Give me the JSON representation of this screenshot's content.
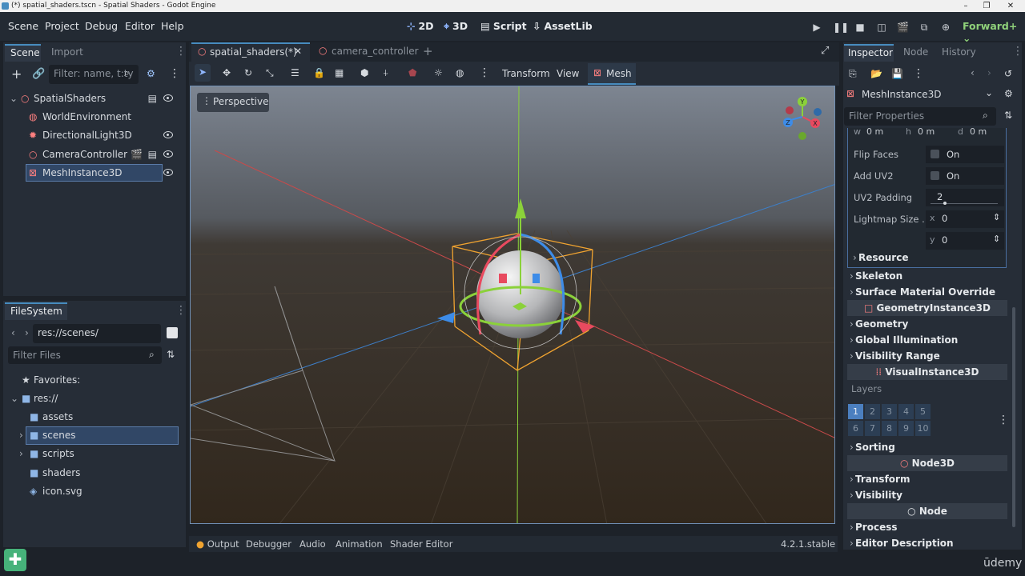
{
  "window": {
    "title": "(*) spatial_shaders.tscn - Spatial Shaders - Godot Engine"
  },
  "menu": [
    "Scene",
    "Project",
    "Debug",
    "Editor",
    "Help"
  ],
  "workspaces": [
    {
      "label": "2D",
      "icon": "2d-icon"
    },
    {
      "label": "3D",
      "icon": "3d-icon"
    },
    {
      "label": "Script",
      "icon": "script-icon"
    },
    {
      "label": "AssetLib",
      "icon": "assetlib-icon"
    }
  ],
  "renderer": "Forward+",
  "scene_dock": {
    "tabs": [
      "Scene",
      "Import"
    ],
    "filter_placeholder": "Filter: name, t:ty",
    "nodes": [
      {
        "label": "SpatialShaders",
        "icon": "node3d-icon"
      },
      {
        "label": "WorldEnvironment",
        "icon": "world-environment-icon"
      },
      {
        "label": "DirectionalLight3D",
        "icon": "directional-light-icon"
      },
      {
        "label": "CameraController",
        "icon": "node3d-icon"
      },
      {
        "label": "MeshInstance3D",
        "icon": "mesh-instance-icon"
      }
    ]
  },
  "filesystem": {
    "title": "FileSystem",
    "path": "res://scenes/",
    "filter_placeholder": "Filter Files",
    "favorites": "Favorites:",
    "root": "res://",
    "items": [
      "assets",
      "scenes",
      "scripts",
      "shaders",
      "icon.svg"
    ]
  },
  "editor_tabs": [
    {
      "label": "spatial_shaders(*)",
      "active": true
    },
    {
      "label": "camera_controller",
      "active": false
    }
  ],
  "viewport": {
    "menu": [
      "Transform",
      "View",
      "Mesh"
    ],
    "perspective": "Perspective",
    "gizmo_axes": [
      "Y",
      "X",
      "Z"
    ]
  },
  "inspector": {
    "tabs": [
      "Inspector",
      "Node",
      "History"
    ],
    "node_name": "MeshInstance3D",
    "filter_placeholder": "Filter Properties",
    "size_row": {
      "w": "0 m",
      "h": "0 m",
      "d": "0 m",
      "w_label": "w",
      "h_label": "h",
      "d_label": "d"
    },
    "props": [
      {
        "label": "Flip Faces",
        "value": "On"
      },
      {
        "label": "Add UV2",
        "value": "On"
      },
      {
        "label": "UV2 Padding",
        "value": "2"
      },
      {
        "label": "Lightmap Size ...",
        "x_label": "x",
        "x": "0",
        "y_label": "y",
        "y": "0"
      }
    ],
    "resource": "Resource",
    "sections_a": [
      "Skeleton",
      "Surface Material Override"
    ],
    "class_geometry": "GeometryInstance3D",
    "sections_b": [
      "Geometry",
      "Global Illumination",
      "Visibility Range"
    ],
    "class_visual": "VisualInstance3D",
    "layers_label": "Layers",
    "layers": [
      "1",
      "2",
      "3",
      "4",
      "5",
      "6",
      "7",
      "8",
      "9",
      "10"
    ],
    "sorting": "Sorting",
    "class_node3d": "Node3D",
    "sections_c": [
      "Transform",
      "Visibility"
    ],
    "class_node": "Node",
    "sections_d": [
      "Process",
      "Editor Description"
    ]
  },
  "bottom_panel": {
    "tabs": [
      "Output",
      "Debugger",
      "Audio",
      "Animation",
      "Shader Editor"
    ],
    "version": "4.2.1.stable"
  },
  "watermark": "ūdemy",
  "colors": {
    "accent": "#478cbf",
    "axis_x": "#e84a5f",
    "axis_y": "#8bd13a",
    "axis_z": "#3d8ce8",
    "selection_box": "#f0a330"
  }
}
